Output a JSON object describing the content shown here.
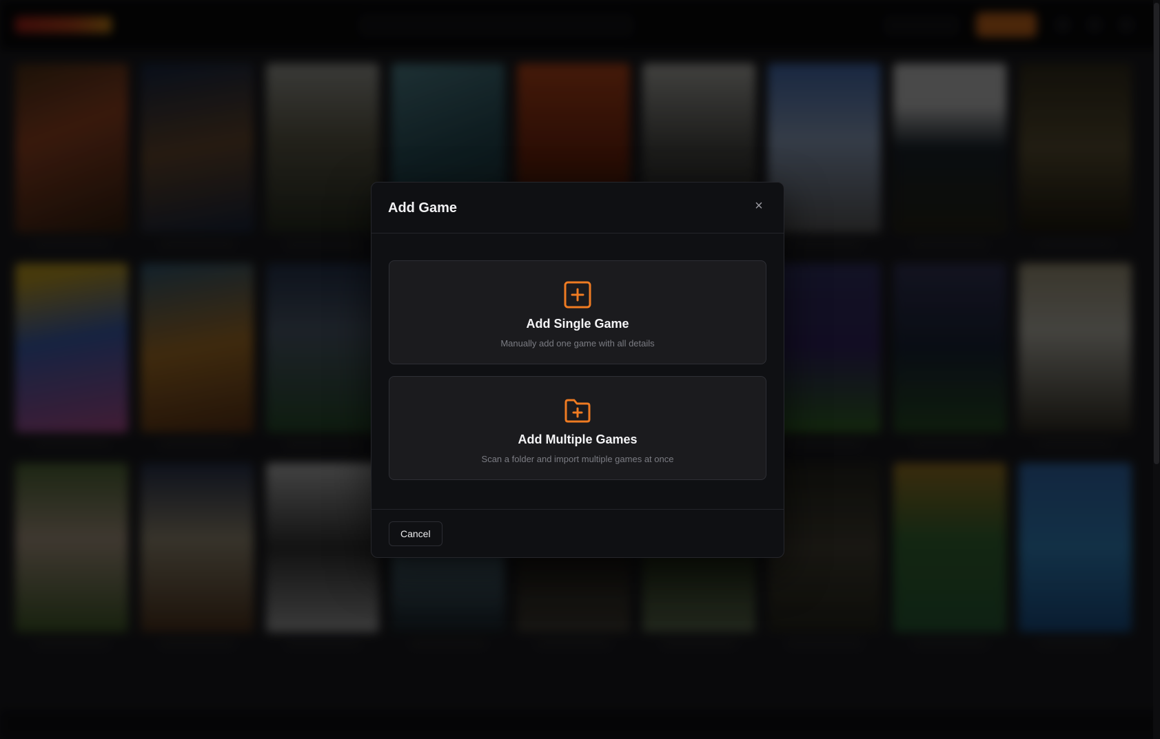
{
  "modal": {
    "title": "Add Game",
    "close_glyph": "×",
    "options": [
      {
        "title": "Add Single Game",
        "description": "Manually add one game with all details",
        "icon": "plus-square-icon"
      },
      {
        "title": "Add Multiple Games",
        "description": "Scan a folder and import multiple games at once",
        "icon": "folder-plus-icon"
      }
    ],
    "cancel_label": "Cancel"
  },
  "colors": {
    "accent": "#ef7b22",
    "modal_bg": "#0f1013",
    "option_bg": "#1b1b1e"
  }
}
